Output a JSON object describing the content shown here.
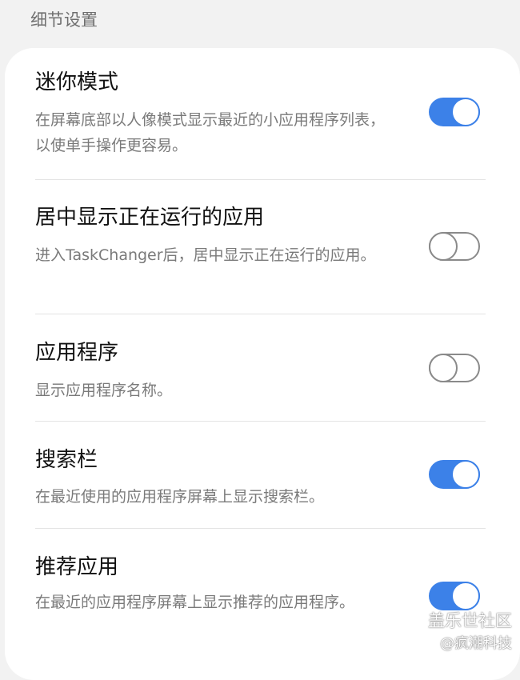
{
  "section_header": "细节设置",
  "settings": [
    {
      "title": "迷你模式",
      "description": "在屏幕底部以人像模式显示最近的小应用程序列表，以使单手操作更容易。",
      "enabled": true
    },
    {
      "title": "居中显示正在运行的应用",
      "description": "进入TaskChanger后，居中显示正在运行的应用。",
      "enabled": false
    },
    {
      "title": "应用程序",
      "description": "显示应用程序名称。",
      "enabled": false
    },
    {
      "title": "搜索栏",
      "description": "在最近使用的应用程序屏幕上显示搜索栏。",
      "enabled": true
    },
    {
      "title": "推荐应用",
      "description": "在最近的应用程序屏幕上显示推荐的应用程序。",
      "enabled": true
    }
  ],
  "watermark": {
    "line1": "盖乐世社区",
    "line2": "@疯潮科技"
  },
  "colors": {
    "accent": "#3c81e8",
    "background": "#f2f2f2",
    "card": "#ffffff"
  }
}
